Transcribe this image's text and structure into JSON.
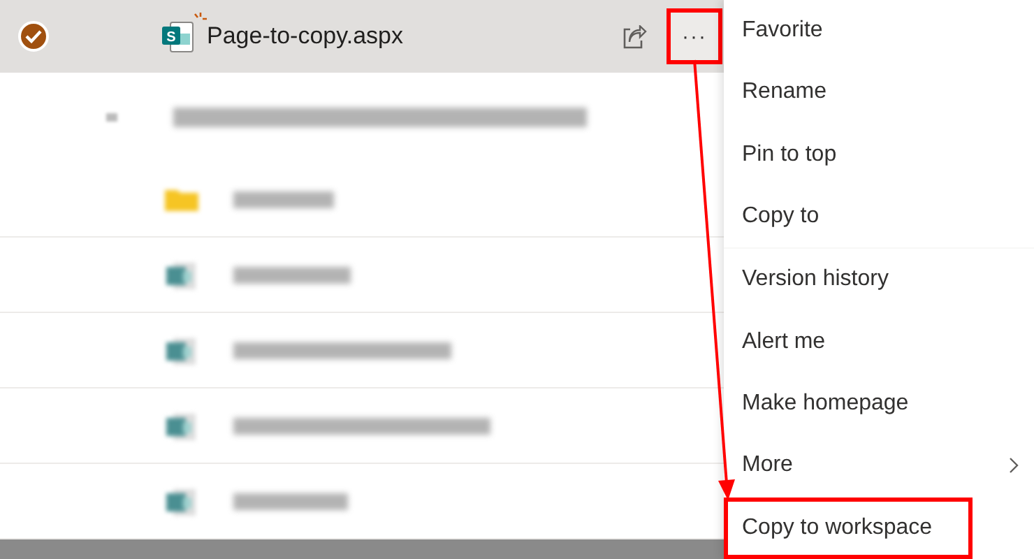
{
  "selected_file": {
    "icon_letter": "S",
    "name": "Page-to-copy.aspx",
    "selected": true,
    "is_new": true,
    "more_button": {
      "label": "···",
      "highlighted": true
    }
  },
  "group_header": {
    "blurred": true
  },
  "rows": [
    {
      "kind": "folder"
    },
    {
      "kind": "page"
    },
    {
      "kind": "page"
    },
    {
      "kind": "page"
    },
    {
      "kind": "page"
    }
  ],
  "context_menu": [
    {
      "label": "Favorite",
      "highlighted": false,
      "divider_after": false,
      "submenu": false
    },
    {
      "label": "Rename",
      "highlighted": false,
      "divider_after": false,
      "submenu": false
    },
    {
      "label": "Pin to top",
      "highlighted": false,
      "divider_after": false,
      "submenu": false
    },
    {
      "label": "Copy to",
      "highlighted": false,
      "divider_after": true,
      "submenu": false
    },
    {
      "label": "Version history",
      "highlighted": false,
      "divider_after": false,
      "submenu": false
    },
    {
      "label": "Alert me",
      "highlighted": false,
      "divider_after": false,
      "submenu": false
    },
    {
      "label": "Make homepage",
      "highlighted": false,
      "divider_after": false,
      "submenu": false
    },
    {
      "label": "More",
      "highlighted": false,
      "divider_after": false,
      "submenu": true
    },
    {
      "label": "Copy to workspace",
      "highlighted": true,
      "divider_after": false,
      "submenu": false
    }
  ],
  "callout_arrow": true
}
